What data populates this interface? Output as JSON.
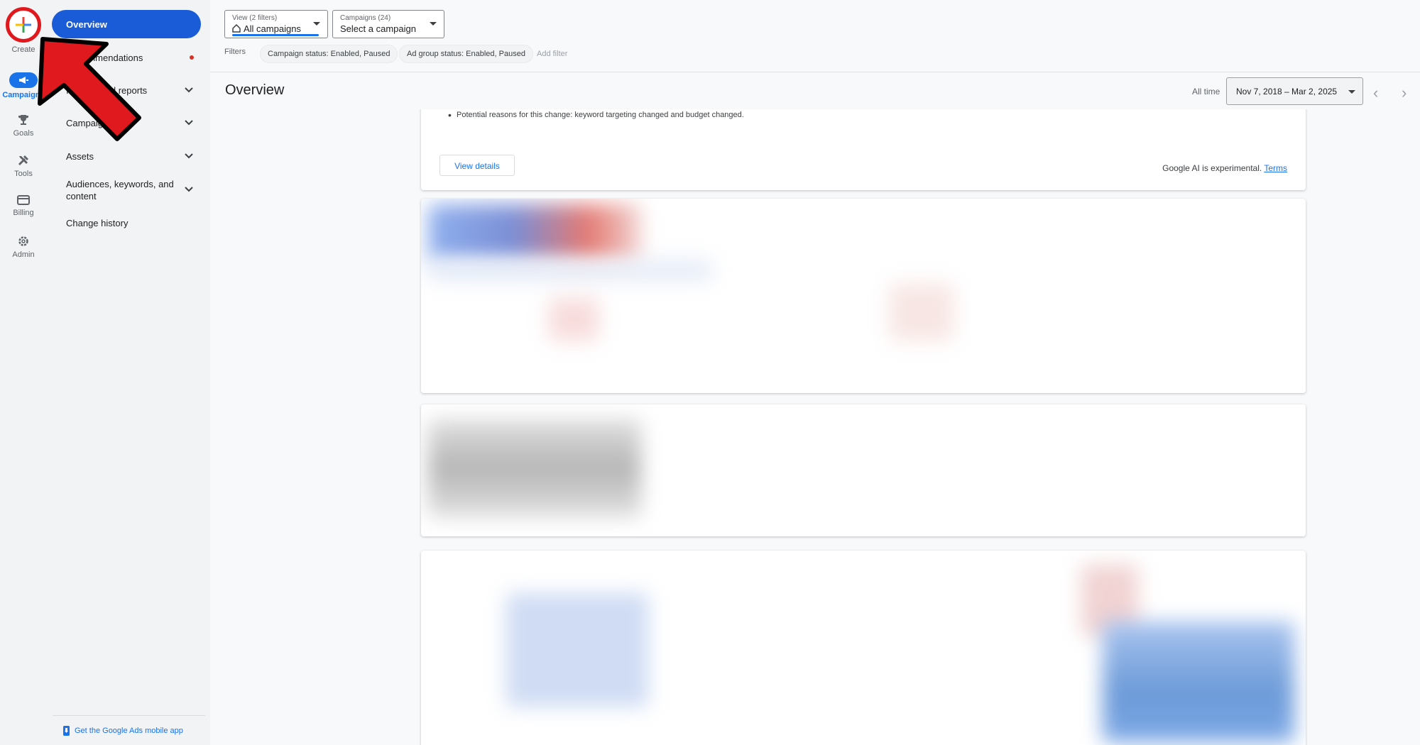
{
  "rail": {
    "create_label": "Create",
    "items": [
      {
        "label": "Campaigns",
        "icon": "megaphone-icon",
        "active": true
      },
      {
        "label": "Goals",
        "icon": "trophy-icon"
      },
      {
        "label": "Tools",
        "icon": "tools-icon"
      },
      {
        "label": "Billing",
        "icon": "credit-card-icon"
      },
      {
        "label": "Admin",
        "icon": "gear-icon"
      }
    ]
  },
  "nav": {
    "overview": "Overview",
    "recommendations": "Recommendations",
    "insights_reports": "Insights and reports",
    "campaigns": "Campaigns",
    "assets": "Assets",
    "audiences_line1": "Audiences, keywords, and",
    "audiences_line2": "content",
    "change_history": "Change history",
    "mobile_app": "Get the Google Ads mobile app"
  },
  "header": {
    "view_small": "View (2 filters)",
    "view_value": "All campaigns",
    "campaigns_small": "Campaigns (24)",
    "campaigns_value": "Select a campaign",
    "filters_label": "Filters",
    "chip1": "Campaign status: Enabled, Paused",
    "chip2": "Ad group status: Enabled, Paused",
    "add_filter": "Add filter"
  },
  "page": {
    "title": "Overview",
    "alltime": "All time",
    "date_range": "Nov 7, 2018 – Mar 2, 2025"
  },
  "ai_card": {
    "bullet": "Potential reasons for this change: keyword targeting changed and budget changed.",
    "view_details": "View details",
    "note": "Google AI is experimental.",
    "terms": "Terms"
  },
  "colors": {
    "accent": "#1a73e8",
    "overview_pill": "#1a5cd8",
    "annotation_red": "#e0191f"
  }
}
